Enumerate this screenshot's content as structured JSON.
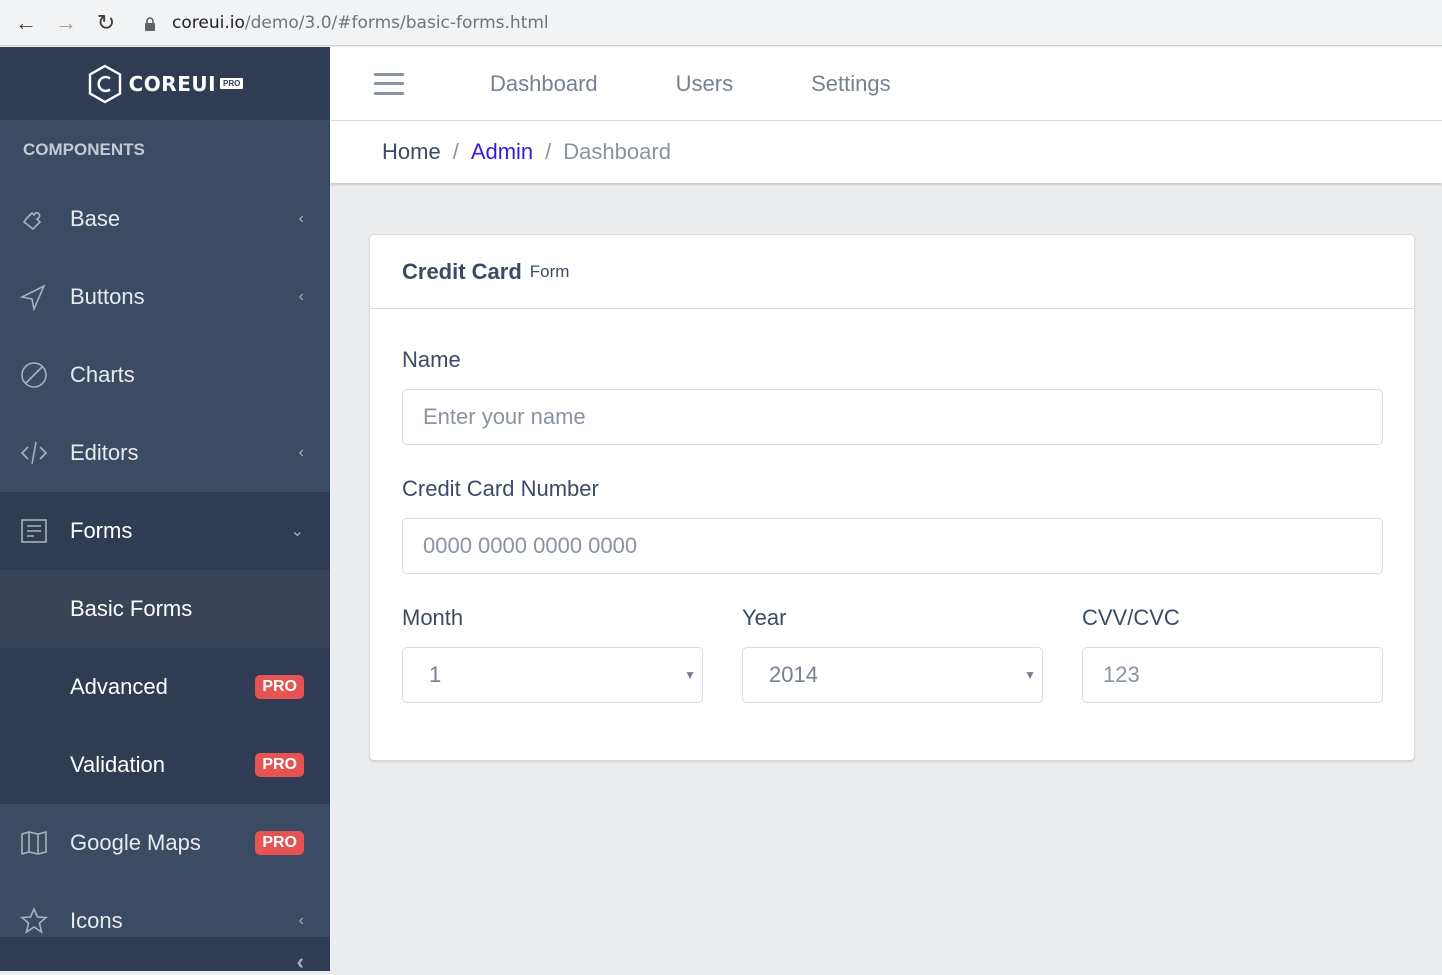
{
  "browser": {
    "url_host": "coreui.io",
    "url_path": "/demo/3.0/#forms/basic-forms.html"
  },
  "sidebar": {
    "brand": "COREUI",
    "brand_badge": "PRO",
    "section_title": "COMPONENTS",
    "items": [
      {
        "label": "Base",
        "icon": "puzzle-icon"
      },
      {
        "label": "Buttons",
        "icon": "cursor-icon"
      },
      {
        "label": "Charts",
        "icon": "chart-pie-icon"
      },
      {
        "label": "Editors",
        "icon": "code-icon"
      },
      {
        "label": "Forms",
        "icon": "notes-icon"
      }
    ],
    "forms_children": [
      {
        "label": "Basic Forms"
      },
      {
        "label": "Advanced",
        "badge": "PRO"
      },
      {
        "label": "Validation",
        "badge": "PRO"
      }
    ],
    "after": [
      {
        "label": "Google Maps",
        "badge": "PRO",
        "icon": "map-icon"
      },
      {
        "label": "Icons",
        "icon": "star-icon"
      }
    ]
  },
  "header": {
    "nav": [
      "Dashboard",
      "Users",
      "Settings"
    ]
  },
  "breadcrumb": [
    "Home",
    "Admin",
    "Dashboard"
  ],
  "card": {
    "title": "Credit Card",
    "subtitle": "Form",
    "fields": {
      "name_label": "Name",
      "name_placeholder": "Enter your name",
      "ccn_label": "Credit Card Number",
      "ccn_placeholder": "0000 0000 0000 0000",
      "month_label": "Month",
      "month_value": "1",
      "year_label": "Year",
      "year_value": "2014",
      "cvv_label": "CVV/CVC",
      "cvv_placeholder": "123"
    }
  },
  "colors": {
    "badge": "#e55353",
    "link": "#321fdb",
    "sidebar": "#3c4b64"
  }
}
